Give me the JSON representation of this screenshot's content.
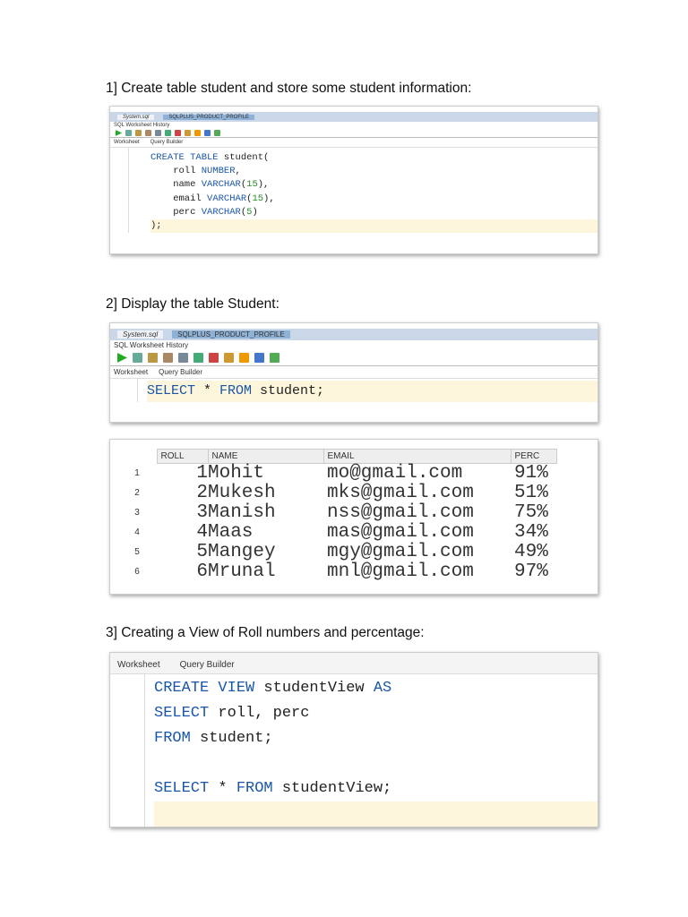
{
  "headings": [
    "1] Create table student and store some student information:",
    "2] Display the table Student:",
    "3] Creating  a View of Roll numbers and percentage:"
  ],
  "ide": {
    "tab_file": "System.sql",
    "tab_table": "SQLPLUS_PRODUCT_PROFILE",
    "sub_tabs": [
      "SQL Worksheet",
      "History"
    ],
    "editor_tabs": [
      "Worksheet",
      "Query Builder"
    ]
  },
  "code1": [
    [
      {
        "t": "CREATE TABLE",
        "k": "kw"
      },
      {
        "t": " student("
      }
    ],
    [
      {
        "t": "    roll "
      },
      {
        "t": "NUMBER",
        "k": "kw"
      },
      {
        "t": ","
      }
    ],
    [
      {
        "t": "    name "
      },
      {
        "t": "VARCHAR",
        "k": "kw"
      },
      {
        "t": "("
      },
      {
        "t": "15",
        "k": "str"
      },
      {
        "t": "),"
      }
    ],
    [
      {
        "t": "    email "
      },
      {
        "t": "VARCHAR",
        "k": "kw"
      },
      {
        "t": "("
      },
      {
        "t": "15",
        "k": "str"
      },
      {
        "t": "),"
      }
    ],
    [
      {
        "t": "    perc "
      },
      {
        "t": "VARCHAR",
        "k": "kw"
      },
      {
        "t": "("
      },
      {
        "t": "5",
        "k": "str"
      },
      {
        "t": ")"
      }
    ],
    [
      {
        "t": ");"
      }
    ]
  ],
  "code2": [
    [
      {
        "t": "SELECT",
        "k": "kw"
      },
      {
        "t": " * "
      },
      {
        "t": "FROM",
        "k": "kw"
      },
      {
        "t": " student;"
      }
    ]
  ],
  "code3": [
    [
      {
        "t": "CREATE VIEW",
        "k": "kw"
      },
      {
        "t": " studentView "
      },
      {
        "t": "AS",
        "k": "kw"
      }
    ],
    [
      {
        "t": "SELECT",
        "k": "kw"
      },
      {
        "t": " roll, perc"
      }
    ],
    [
      {
        "t": "FROM",
        "k": "kw"
      },
      {
        "t": " student;"
      }
    ],
    [
      {
        "t": ""
      }
    ],
    [
      {
        "t": "SELECT",
        "k": "kw"
      },
      {
        "t": " * "
      },
      {
        "t": "FROM",
        "k": "kw"
      },
      {
        "t": " studentView;"
      }
    ],
    [
      {
        "t": ""
      }
    ]
  ],
  "table": {
    "columns": [
      "ROLL",
      "NAME",
      "EMAIL",
      "PERC"
    ],
    "rows": [
      [
        "1",
        "1",
        "Mohit",
        "mo@gmail.com",
        "91%"
      ],
      [
        "2",
        "2",
        "Mukesh",
        "mks@gmail.com",
        "51%"
      ],
      [
        "3",
        "3",
        "Manish",
        "nss@gmail.com",
        "75%"
      ],
      [
        "4",
        "4",
        "Maas",
        "mas@gmail.com",
        "34%"
      ],
      [
        "5",
        "5",
        "Mangey",
        "mgy@gmail.com",
        "49%"
      ],
      [
        "6",
        "6",
        "Mrunal",
        "mnl@gmail.com",
        "97%"
      ]
    ]
  }
}
